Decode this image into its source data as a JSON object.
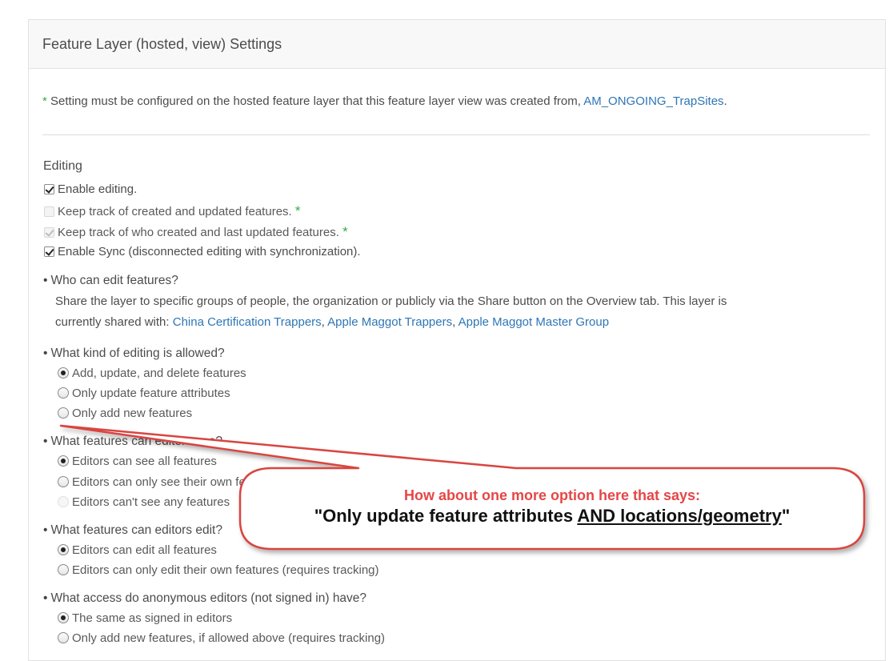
{
  "header": {
    "title": "Feature Layer (hosted, view) Settings"
  },
  "note": {
    "asterisk": "*",
    "text": "Setting must be configured on the hosted feature layer that this feature layer view was created from,",
    "link": "AM_ONGOING_TrapSites",
    "period": "."
  },
  "editing": {
    "heading": "Editing",
    "checkboxes": [
      {
        "label": "Enable editing.",
        "checked": true,
        "disabled": false,
        "asterisk": ""
      },
      {
        "label": "Keep track of created and updated features.",
        "checked": false,
        "disabled": true,
        "asterisk": "*"
      },
      {
        "label": "Keep track of who created and last updated features.",
        "checked": true,
        "disabled": true,
        "asterisk": "*"
      },
      {
        "label": "Enable Sync (disconnected editing with synchronization).",
        "checked": true,
        "disabled": false,
        "asterisk": ""
      }
    ]
  },
  "who_can_edit": {
    "question": "Who can edit features?",
    "line1": "Share the layer to specific groups of people, the organization or publicly via the Share button on the Overview tab. This layer is",
    "line2_prefix": "currently shared with:",
    "groups": [
      "China Certification Trappers",
      "Apple Maggot Trappers",
      "Apple Maggot Master Group"
    ],
    "separator": ","
  },
  "editing_kind": {
    "question": "What kind of editing is allowed?",
    "options": [
      "Add, update, and delete features",
      "Only update feature attributes",
      "Only add new features"
    ],
    "selected": 0
  },
  "features_see": {
    "question": "What features can editors see?",
    "options": [
      "Editors can see all features",
      "Editors can only see their own features (requires tracking)",
      "Editors can't see any features"
    ],
    "selected": 0
  },
  "features_edit": {
    "question": "What features can editors edit?",
    "options": [
      "Editors can edit all features",
      "Editors can only edit their own features (requires tracking)"
    ],
    "selected": 0
  },
  "anonymous": {
    "question": "What access do anonymous editors (not signed in) have?",
    "options": [
      "The same as signed in editors",
      "Only add new features, if allowed above (requires tracking)"
    ],
    "selected": 0
  },
  "callout": {
    "line1": "How about one more option here that says:",
    "line2_prefix": "\"Only update feature attributes ",
    "line2_underlined": "AND locations/geometry",
    "line2_suffix": "\"",
    "colors": {
      "border": "#d9443f",
      "title": "#e64646",
      "body": "#111111"
    }
  }
}
